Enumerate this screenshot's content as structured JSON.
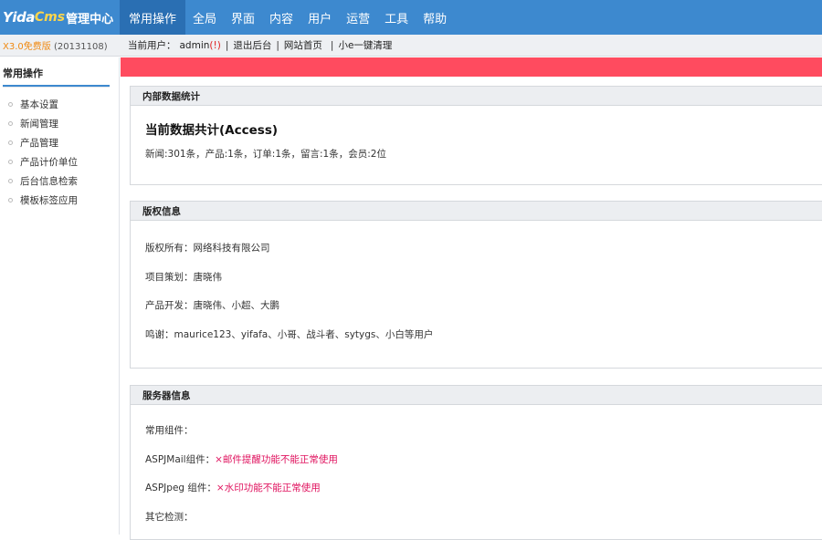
{
  "app": {
    "logo_part1": "Yida",
    "logo_part2": "Cms",
    "logo_part3": "管理中心"
  },
  "nav": {
    "items": [
      "常用操作",
      "全局",
      "界面",
      "内容",
      "用户",
      "运营",
      "工具",
      "帮助"
    ]
  },
  "infobar": {
    "version_tag": "X3.0免费版",
    "version_date": "(20131108)",
    "current_user_label": "当前用户：",
    "username": "admin",
    "warning": "(!)",
    "sep": "|",
    "links": [
      "退出后台",
      "网站首页",
      "小e一键清理"
    ]
  },
  "sidebar": {
    "title": "常用操作",
    "items": [
      "基本设置",
      "新闻管理",
      "产品管理",
      "产品计价单位",
      "后台信息检索",
      "模板标签应用"
    ]
  },
  "panels": {
    "stats": {
      "header": "内部数据统计",
      "title": "当前数据共计(Access)",
      "line": "新闻:301条，产品:1条，订单:1条，留言:1条，会员:2位"
    },
    "copyright": {
      "header": "版权信息",
      "rows": [
        "版权所有：网络科技有限公司",
        "项目策划：唐晓伟",
        "产品开发：唐晓伟、小超、大鹏",
        "鸣谢：maurice123、yifafa、小哥、战斗者、sytygs、小白等用户"
      ]
    },
    "server": {
      "header": "服务器信息",
      "common_label": "常用组件：",
      "components": [
        {
          "name": "ASPJMail组件：",
          "status": "×邮件提醒功能不能正常使用",
          "color": "#e0135f"
        },
        {
          "name": "ASPJpeg 组件：",
          "status": "×水印功能不能正常使用",
          "color": "#e0135f"
        }
      ],
      "other_label": "其它检测："
    }
  },
  "colors": {
    "topbar": "#3d89cf",
    "alert_bar": "#ff4b5f",
    "error_text": "#e0135f"
  }
}
